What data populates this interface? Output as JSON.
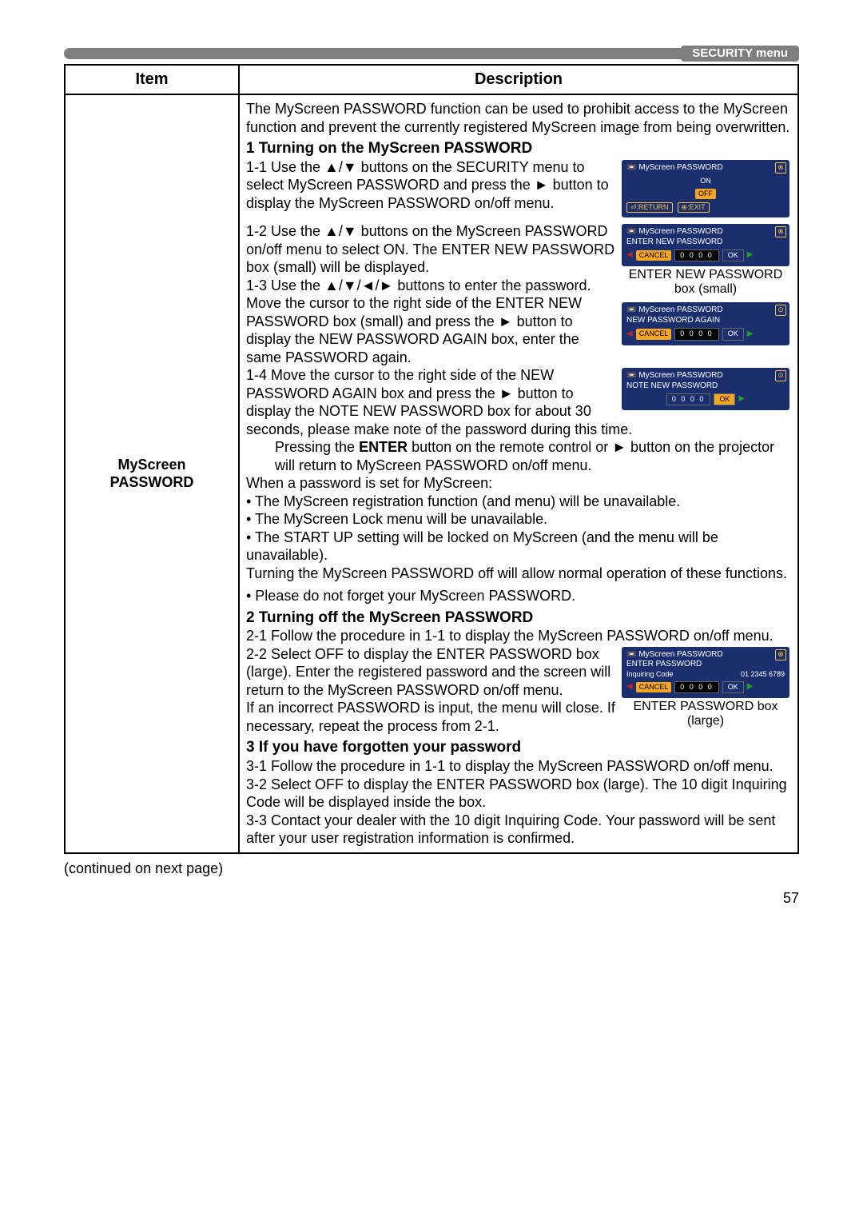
{
  "header_tab": "SECURITY menu",
  "table": {
    "col_item": "Item",
    "col_desc": "Description",
    "item_name_l1": "MyScreen",
    "item_name_l2": "PASSWORD",
    "intro": "The MyScreen PASSWORD function can be used to prohibit access to the MyScreen function and prevent the currently registered MyScreen image from being overwritten.",
    "s1_title": "1 Turning on the MyScreen PASSWORD",
    "s1_1": "1-1 Use the ▲/▼ buttons on the SECURITY menu to select MyScreen PASSWORD and press the ► button to display the MyScreen PASSWORD on/off menu.",
    "s1_2": "1-2 Use the ▲/▼ buttons on the MyScreen PASSWORD on/off menu to select ON. The ENTER NEW PASSWORD box (small) will be displayed.",
    "s1_3": "1-3 Use the ▲/▼/◄/► buttons to enter the password. Move the cursor to the right side of the ENTER NEW PASSWORD box (small) and press the ► button to display the NEW PASSWORD AGAIN box, enter the same PASSWORD again.",
    "s1_4": "1-4 Move the cursor to the right side of the NEW PASSWORD AGAIN box and press the ► button to display the NOTE NEW PASSWORD box for about 30 seconds, please make note of the password during this time.",
    "s1_tail_a": "Pressing the ",
    "s1_tail_enter": "ENTER",
    "s1_tail_b": " button on the remote control or ► button on the projector will return to MyScreen PASSWORD on/off menu.",
    "when_set": "When a password is set for MyScreen:",
    "bul1": "• The MyScreen registration function (and menu) will be unavailable.",
    "bul2": "• The MyScreen Lock menu will be unavailable.",
    "bul3": "• The START UP setting will be locked on MyScreen (and the menu will be unavailable).",
    "turn_off_line": "Turning the MyScreen PASSWORD off will allow normal operation of these functions.",
    "dont_forget": "• Please do not forget your MyScreen PASSWORD.",
    "s2_title": "2 Turning off the MyScreen PASSWORD",
    "s2_1": "2-1 Follow the procedure in 1-1 to display the MyScreen PASSWORD on/off menu.",
    "s2_2": "2-2 Select OFF to display the ENTER PASSWORD box (large). Enter the registered password and the screen will return to the MyScreen PASSWORD on/off menu.",
    "s2_tail": "If an incorrect PASSWORD is input, the menu will close. If necessary, repeat the process from 2-1.",
    "s3_title": "3 If you have forgotten your password",
    "s3_1": "3-1 Follow the procedure in 1-1 to display the MyScreen PASSWORD on/off menu.",
    "s3_2": "3-2 Select OFF to display the ENTER PASSWORD box (large). The 10 digit Inquiring Code will be displayed inside the box.",
    "s3_3": "3-3 Contact your dealer with the 10 digit Inquiring Code. Your password will be sent after your user registration information is confirmed."
  },
  "osd": {
    "ttl": "MyScreen PASSWORD",
    "on": "ON",
    "off": "OFF",
    "return": "⏎:RETURN",
    "exit": "⊕:EXIT",
    "enter_new": "ENTER NEW PASSWORD",
    "again": "NEW PASSWORD AGAIN",
    "note": "NOTE NEW PASSWORD",
    "enter_pw": "ENTER PASSWORD",
    "inq": "Inquiring Code",
    "inq_no": "01 2345 6789",
    "cancel": "CANCEL",
    "digits": "0 0 0 0",
    "ok": "OK",
    "cap_enter_small_l1": "ENTER NEW PASSWORD",
    "cap_enter_small_l2": "box (small)",
    "cap_enter_large_l1": "ENTER PASSWORD box",
    "cap_enter_large_l2": "(large)"
  },
  "continued": "(continued on next page)",
  "page_number": "57"
}
